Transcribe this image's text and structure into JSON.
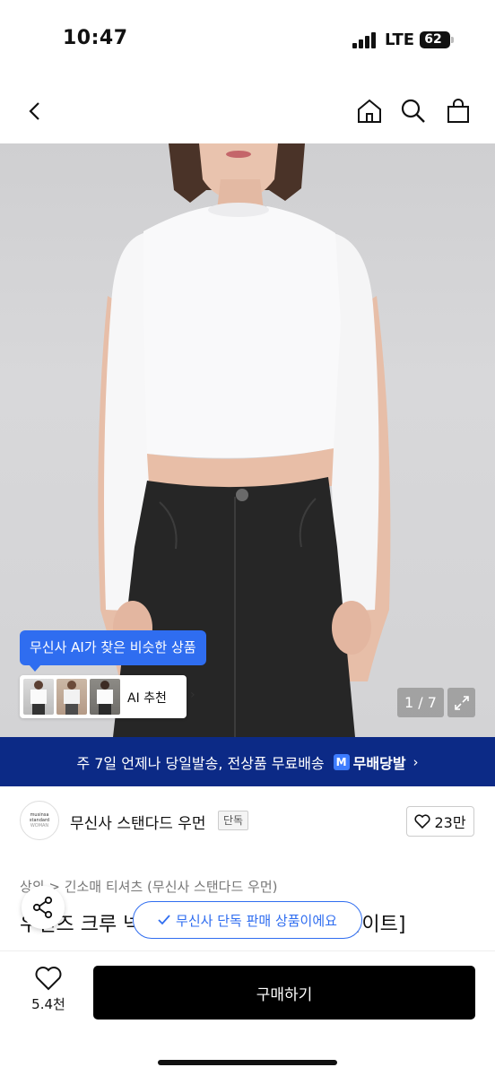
{
  "status_bar": {
    "time": "10:47",
    "network": "LTE",
    "battery": "62"
  },
  "nav": {
    "icons": [
      "back-icon",
      "home-icon",
      "search-icon",
      "shopping-bag-icon"
    ]
  },
  "gallery": {
    "ai_tooltip": "무신사 AI가 찾은 비슷한 상품",
    "ai_recommend_label": "AI 추천",
    "counter": "1 / 7"
  },
  "shipping_banner": {
    "text": "주 7일 언제나 당일발송, 전상품 무료배송",
    "brand": "무배당발",
    "colors": {
      "background": "#0c2a86",
      "logo": "#3d7cff"
    }
  },
  "brand": {
    "logo_lines": [
      "musinsa",
      "standard",
      "WOMAN"
    ],
    "name": "무신사 스탠다드 우먼",
    "tag": "단독",
    "likes": "23만"
  },
  "product": {
    "category": "상의 > 긴소매 티셔츠 (무신사 스탠다드 우먼)",
    "title": "우먼즈 크루 넥 크롭 롱 슬리브 티셔츠 [화이트]"
  },
  "exclusive_pill": "무신사 단독 판매 상품이에요",
  "bottom_bar": {
    "fav_count": "5.4천",
    "buy_label": "구매하기"
  },
  "accent_color": "#2f6df0"
}
